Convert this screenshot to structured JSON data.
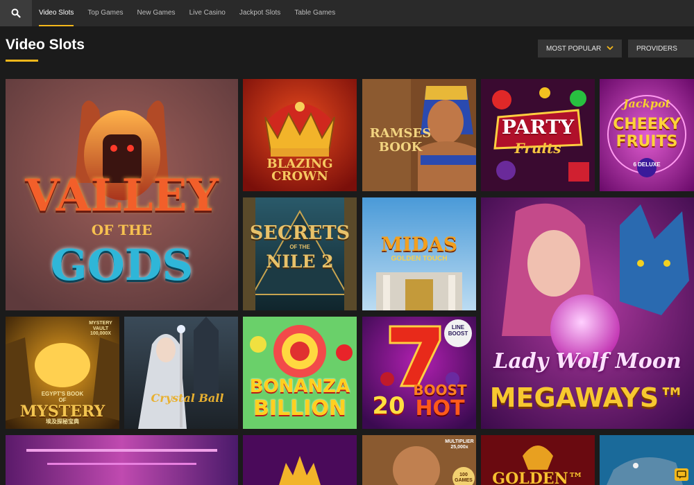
{
  "nav": {
    "search_icon": "search-icon",
    "items": [
      "Video Slots",
      "Top Games",
      "New Games",
      "Live Casino",
      "Jackpot Slots",
      "Table Games"
    ],
    "active": "Video Slots"
  },
  "heading": {
    "title": "Video Slots"
  },
  "filters": {
    "sort_label": "MOST POPULAR",
    "providers_label": "PROVIDERS"
  },
  "colors": {
    "accent": "#f4b81b",
    "topbar": "#2a2a2a",
    "page_bg": "#1b1b1b",
    "control_bg": "#353535"
  },
  "games": {
    "valley": {
      "line1": "VALLEY",
      "line2": "OF THE",
      "line3": "GODS"
    },
    "blazing": {
      "line1": "BLAZING",
      "line2": "CROWN"
    },
    "ramses": {
      "line1": "RAMSES",
      "line2": "BOOK"
    },
    "party": {
      "line1": "PARTY",
      "line2": "Fruits"
    },
    "cheeky": {
      "line1": "Jackpot",
      "line2": "CHEEKY",
      "line3": "FRUITS",
      "badge": "6 DELUXE"
    },
    "secrets": {
      "line1": "SECRETS",
      "line2": "OF THE",
      "line3": "NILE 2"
    },
    "midas": {
      "line1": "MIDAS",
      "line2": "GOLDEN TOUCH"
    },
    "ladywolf": {
      "line1": "Lady Wolf Moon",
      "line2": "MEGAWAYS™"
    },
    "egypt": {
      "line1": "EGYPT'S BOOK",
      "line2": "OF",
      "line3": "MYSTERY",
      "line4": "埃及探秘宝典",
      "badge": "MYSTERY VAULT 100,000X"
    },
    "crystal": {
      "line1": "Crystal Ball"
    },
    "bonanza": {
      "line1": "BONANZA",
      "line2": "BILLION"
    },
    "boost": {
      "line1": "20",
      "line2": "BOOST",
      "line3": "HOT",
      "badge": "LINE BOOST"
    },
    "multiplier": {
      "badge": "MULTIPLIER 25,000x",
      "coin": "100 GAMES"
    },
    "golden": {
      "line1": "GOLDEN™"
    }
  }
}
